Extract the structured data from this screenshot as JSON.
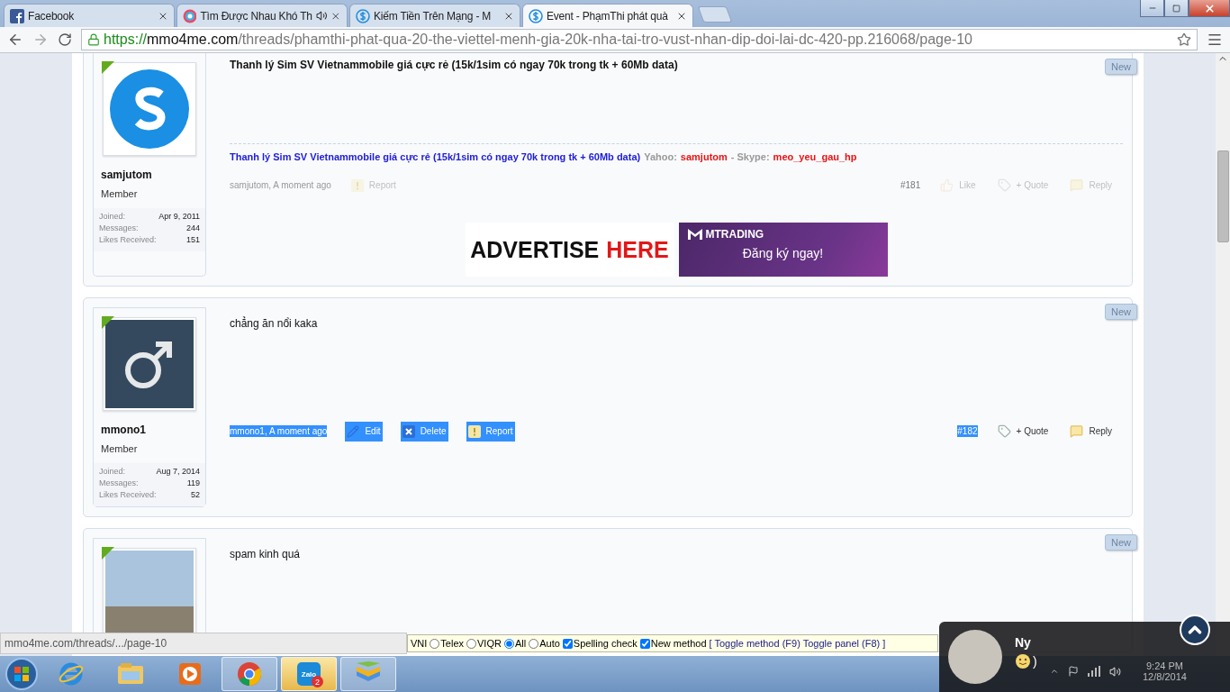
{
  "browser": {
    "tabs": [
      {
        "title": "Facebook",
        "selected": false,
        "kind": "facebook",
        "audio": false
      },
      {
        "title": "Tìm Được Nhau Khó Th",
        "selected": false,
        "kind": "music",
        "audio": true
      },
      {
        "title": "Kiếm Tiền Trên Mạng - M",
        "selected": false,
        "kind": "dollar",
        "audio": false
      },
      {
        "title": "Event - PhạmThi phát quà",
        "selected": true,
        "kind": "dollar",
        "audio": false
      }
    ],
    "url": {
      "scheme": "https://",
      "host": "mmo4me.com",
      "path": "/threads/phamthi-phat-qua-20-the-viettel-menh-gia-20k-nha-tai-tro-vust-nhan-dip-doi-lai-dc-420-pp.216068/page-10"
    }
  },
  "posts": [
    {
      "avatar": {
        "kind": "letter"
      },
      "username": "samjutom",
      "role": "Member",
      "stats": [
        {
          "label": "Joined:",
          "value": "Apr 9, 2011"
        },
        {
          "label": "Messages:",
          "value": "244"
        },
        {
          "label": "Likes Received:",
          "value": "151"
        }
      ],
      "new_badge": "New",
      "body": "Thanh lý Sim SV Vietnammobile giá cực rẻ (15k/1sim có ngay 70k trong tk + 60Mb data)",
      "body_bold": true,
      "signature": [
        {
          "kind": "link",
          "text": "Thanh lý Sim SV Vietnammobile giá cực rẻ (15k/1sim có ngay 70k trong tk + 60Mb data)"
        },
        {
          "kind": "label",
          "text": "Yahoo:"
        },
        {
          "kind": "value",
          "text": "samjutom"
        },
        {
          "kind": "label",
          "text": "- Skype:"
        },
        {
          "kind": "value",
          "text": "meo_yeu_gau_hp"
        }
      ],
      "meta": {
        "text": "samjutom, A moment ago",
        "highlighted": false
      },
      "actions": [
        {
          "kind": "report",
          "label": "Report",
          "faded": true,
          "highlighted": false
        }
      ],
      "number": {
        "text": "#181",
        "highlighted": false
      },
      "controls": [
        {
          "kind": "like",
          "label": "Like",
          "faded": true
        },
        {
          "kind": "quote",
          "label": "+ Quote",
          "faded": true
        },
        {
          "kind": "reply",
          "label": "Reply",
          "faded": true
        }
      ],
      "ad": {
        "headline": "ADVERTISE",
        "accent": "HERE",
        "brand": "MTRADING",
        "cta": "Đăng ký ngay!"
      }
    },
    {
      "avatar": {
        "kind": "symbol"
      },
      "username": "mmono1",
      "role": "Member",
      "stats": [
        {
          "label": "Joined:",
          "value": "Aug 7, 2014"
        },
        {
          "label": "Messages:",
          "value": "119"
        },
        {
          "label": "Likes Received:",
          "value": "52"
        }
      ],
      "new_badge": "New",
      "body": "chẳng ăn nổi kaka",
      "body_bold": false,
      "meta": {
        "text": "mmono1, A moment ago",
        "highlighted": true
      },
      "actions": [
        {
          "kind": "edit",
          "label": "Edit",
          "faded": false,
          "highlighted": true
        },
        {
          "kind": "delete",
          "label": "Delete",
          "faded": false,
          "highlighted": true
        },
        {
          "kind": "report",
          "label": "Report",
          "faded": false,
          "highlighted": true
        }
      ],
      "number": {
        "text": "#182",
        "highlighted": true
      },
      "controls": [
        {
          "kind": "quote",
          "label": "+ Quote",
          "faded": false
        },
        {
          "kind": "reply",
          "label": "Reply",
          "faded": false
        }
      ]
    },
    {
      "avatar": {
        "kind": "photo"
      },
      "new_badge": "New",
      "body": "spam kinh quá",
      "body_bold": false
    }
  ],
  "status_bubble": "mmo4me.com/threads/.../page-10",
  "ime_bar": {
    "items": [
      {
        "kind": "text",
        "label": "VNI"
      },
      {
        "kind": "radio",
        "label": "Telex",
        "selected": false
      },
      {
        "kind": "radio",
        "label": "VIQR",
        "selected": false
      },
      {
        "kind": "radio",
        "label": "All",
        "selected": true
      },
      {
        "kind": "radio",
        "label": "Auto",
        "selected": false
      },
      {
        "kind": "checkbox",
        "label": "Spelling check",
        "checked": true
      },
      {
        "kind": "checkbox",
        "label": "New method",
        "checked": true
      }
    ],
    "shortcuts": "[ Toggle method (F9) Toggle panel (F8) ]"
  },
  "chat_head": {
    "name": "Ny",
    "message": ")"
  },
  "taskbar": {
    "apps": [
      {
        "kind": "ie",
        "running": false,
        "flashing": false
      },
      {
        "kind": "explorer",
        "running": false,
        "flashing": false
      },
      {
        "kind": "media",
        "running": false,
        "flashing": false
      },
      {
        "kind": "chrome",
        "running": true,
        "flashing": false
      },
      {
        "kind": "zalo",
        "running": true,
        "flashing": true,
        "label": "Zalo",
        "badge": "2"
      },
      {
        "kind": "bluestacks",
        "running": true,
        "flashing": false
      }
    ],
    "clock": {
      "time": "9:24 PM",
      "date": "12/8/2014"
    }
  }
}
